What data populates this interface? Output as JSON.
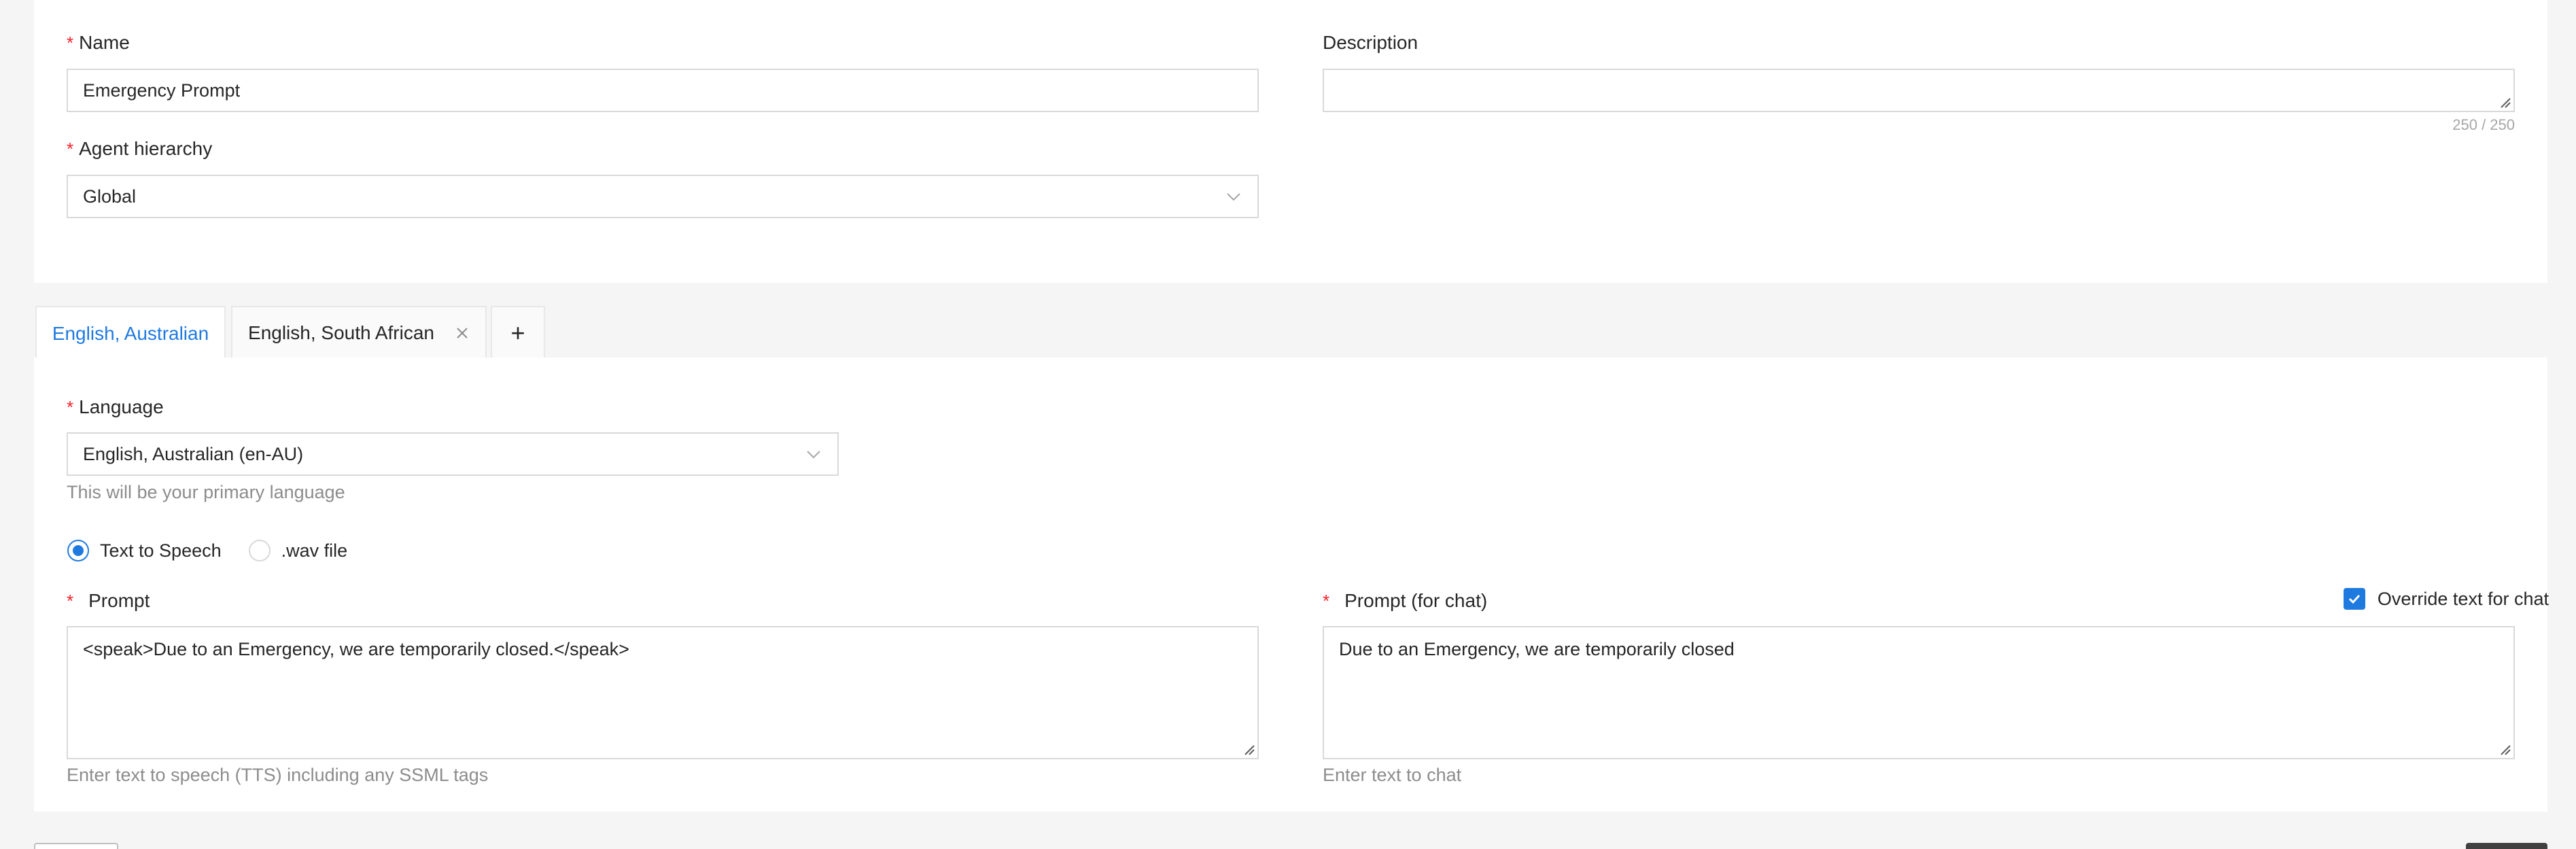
{
  "form": {
    "name_label": "Name",
    "name_value": "Emergency Prompt",
    "description_label": "Description",
    "description_value": "",
    "description_counter": "250 / 250",
    "hierarchy_label": "Agent hierarchy",
    "hierarchy_value": "Global",
    "required_mark": "*"
  },
  "tabs": [
    {
      "label": "English, Australian",
      "active": true
    },
    {
      "label": "English, South African",
      "active": false
    }
  ],
  "add_tab_label": "+",
  "language": {
    "label": "Language",
    "value": "English, Australian (en-AU)",
    "help": "This will be your primary language"
  },
  "mode": {
    "options": [
      {
        "label": "Text to Speech",
        "checked": true
      },
      {
        "label": ".wav file",
        "checked": false
      }
    ]
  },
  "prompt": {
    "label": "Prompt",
    "value": "<speak>Due to an Emergency, we are temporarily closed.</speak>",
    "help": "Enter text to speech (TTS) including any SSML tags"
  },
  "prompt_chat": {
    "label": "Prompt (for chat)",
    "value": "Due to an Emergency, we are temporarily closed",
    "help": "Enter text to chat",
    "override_label": "Override text for chat",
    "override_checked": true
  },
  "colors": {
    "accent": "#1f7ae0",
    "required": "#f5222d",
    "border": "#d9d9d9",
    "background": "#f5f5f5"
  }
}
